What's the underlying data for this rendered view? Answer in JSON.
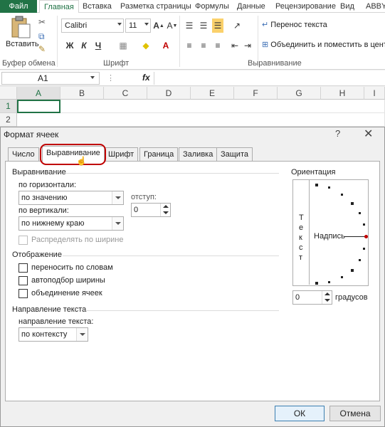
{
  "ribbon_tabs": [
    "Файл",
    "Главная",
    "Вставка",
    "Разметка страницы",
    "Формулы",
    "Данные",
    "Рецензирование",
    "Вид",
    "ABBYY"
  ],
  "ribbon": {
    "paste_label": "Вставить",
    "clipboard_label": "Буфер обмена",
    "font_name": "Calibri",
    "font_size": "11",
    "bold": "Ж",
    "italic": "К",
    "underline": "Ч",
    "font_group_label": "Шрифт",
    "wrap_text": "Перенос текста",
    "merge_center": "Объединить и поместить в центре",
    "alignment_group_label": "Выравнивание"
  },
  "formula_bar": {
    "name_box": "A1",
    "fx": "fx"
  },
  "grid": {
    "columns": [
      "A",
      "B",
      "C",
      "D",
      "E",
      "F",
      "G",
      "H",
      "I"
    ],
    "rows": [
      "1",
      "2"
    ]
  },
  "dialog": {
    "title": "Формат ячеек",
    "help": "?",
    "close": "✕",
    "tabs": [
      "Число",
      "Выравнивание",
      "Шрифт",
      "Граница",
      "Заливка",
      "Защита"
    ],
    "alignment_section": "Выравнивание",
    "horizontal_label": "по горизонтали:",
    "horizontal_value": "по значению",
    "indent_label": "отступ:",
    "indent_value": "0",
    "vertical_label": "по вертикали:",
    "vertical_value": "по нижнему краю",
    "distributed_label": "Распределять по ширине",
    "display_section": "Отображение",
    "wrap_words": "переносить по словам",
    "shrink_fit": "автоподбор ширины",
    "merge_cells": "объединение ячеек",
    "direction_section": "Направление текста",
    "direction_label": "направление текста:",
    "direction_value": "по контексту",
    "orientation_section": "Ориентация",
    "vertical_text": [
      "Т",
      "е",
      "к",
      "с",
      "т"
    ],
    "sample_label": "Надпись",
    "degrees_value": "0",
    "degrees_label": "градусов",
    "ok": "ОК",
    "cancel": "Отмена"
  },
  "colors": {
    "excel_green": "#217346",
    "highlight_red": "#c00000"
  }
}
